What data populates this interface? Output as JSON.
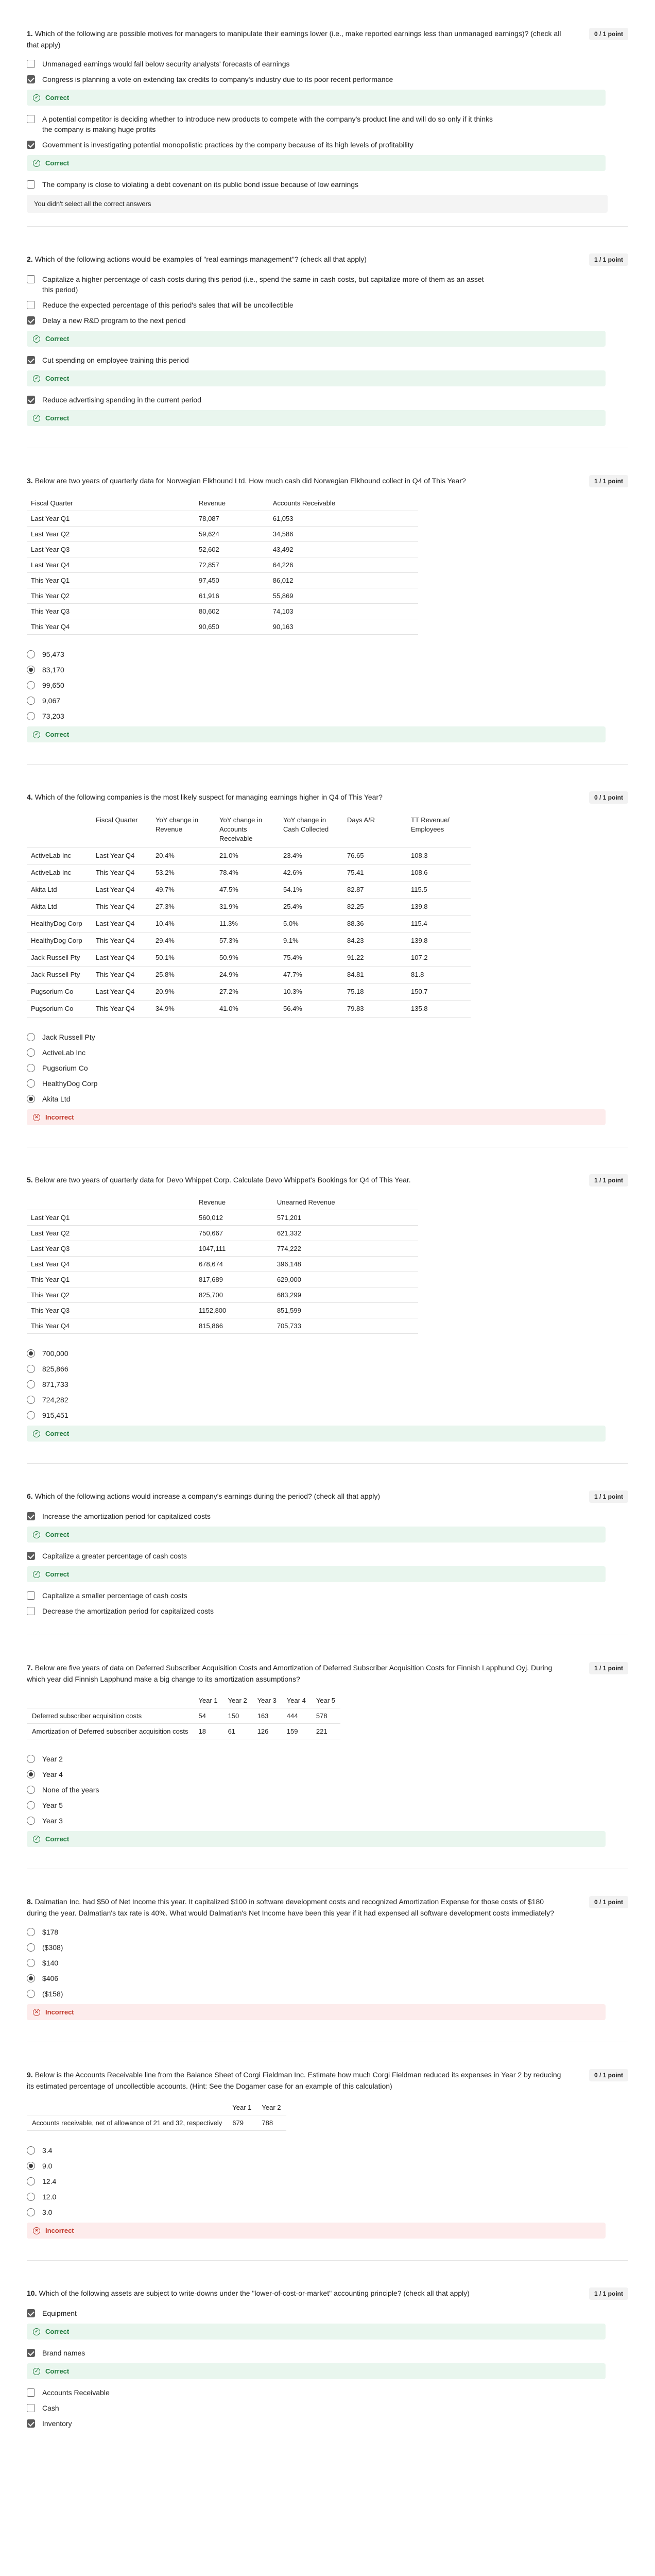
{
  "colors": {
    "correct_bg": "#e9f6ee",
    "correct_text": "#1f7a3d",
    "incorrect_bg": "#fdecec",
    "incorrect_text": "#c0392b",
    "check": "#5a5a5a"
  },
  "icons": {
    "correct": "check-circle-icon",
    "incorrect": "x-circle-icon"
  },
  "q1": {
    "num": "1.",
    "text": "Which of the following are possible motives for managers to manipulate their earnings lower (i.e., make reported earnings less than unmanaged earnings)? (check all that apply)",
    "points": "0 / 1 point",
    "options": [
      {
        "label": "Unmanaged earnings would fall below security analysts' forecasts of earnings",
        "checked": false
      },
      {
        "label": "Congress is planning a vote on extending tax credits to company's industry due to its poor recent performance",
        "checked": true,
        "feedback": "Correct"
      },
      {
        "label": "A potential competitor is deciding whether to introduce new products to compete with the company's product line and will do so only if it thinks the company is making huge profits",
        "checked": false
      },
      {
        "label": "Government is investigating potential monopolistic practices by the company because of its high levels of profitability",
        "checked": true,
        "feedback": "Correct"
      },
      {
        "label": "The company is close to violating a debt covenant on its public bond issue because of low earnings",
        "checked": false
      }
    ],
    "note": "You didn't select all the correct answers"
  },
  "q2": {
    "num": "2.",
    "text": "Which of the following actions would be examples of \"real earnings management\"? (check all that apply)",
    "points": "1 / 1 point",
    "options": [
      {
        "label": "Capitalize a higher percentage of cash costs during this period (i.e., spend the same in cash costs, but capitalize more of them as an asset this period)",
        "checked": false
      },
      {
        "label": "Reduce the expected percentage of this period's sales that will be uncollectible",
        "checked": false
      },
      {
        "label": "Delay a new R&D program to the next period",
        "checked": true,
        "feedback": "Correct"
      },
      {
        "label": "Cut spending on employee training this period",
        "checked": true,
        "feedback": "Correct"
      },
      {
        "label": "Reduce advertising spending in the current period",
        "checked": true,
        "feedback": "Correct"
      }
    ]
  },
  "q3": {
    "num": "3.",
    "text": "Below are two years of quarterly data for Norwegian Elkhound Ltd. How much cash did Norwegian Elkhound collect in Q4 of This Year?",
    "points": "1 / 1 point",
    "headers": [
      "Fiscal Quarter",
      "Revenue",
      "Accounts Receivable"
    ],
    "rows": [
      [
        "Last Year Q1",
        "78,087",
        "61,053"
      ],
      [
        "Last Year Q2",
        "59,624",
        "34,586"
      ],
      [
        "Last Year Q3",
        "52,602",
        "43,492"
      ],
      [
        "Last Year Q4",
        "72,857",
        "64,226"
      ],
      [
        "This Year Q1",
        "97,450",
        "86,012"
      ],
      [
        "This Year Q2",
        "61,916",
        "55,869"
      ],
      [
        "This Year Q3",
        "80,602",
        "74,103"
      ],
      [
        "This Year Q4",
        "90,650",
        "90,163"
      ]
    ],
    "options": [
      {
        "label": "95,473",
        "checked": false
      },
      {
        "label": "83,170",
        "checked": true
      },
      {
        "label": "99,650",
        "checked": false
      },
      {
        "label": "9,067",
        "checked": false
      },
      {
        "label": "73,203",
        "checked": false
      }
    ],
    "feedback": "Correct"
  },
  "q4": {
    "num": "4.",
    "text": "Which of the following companies is the most likely suspect for managing earnings higher in Q4 of This Year?",
    "points": "0 / 1 point",
    "headers": [
      "",
      "Fiscal Quarter",
      "YoY change in Revenue",
      "YoY change in Accounts Receivable",
      "YoY change in Cash Collected",
      "Days A/R",
      "TT Revenue/ Employees"
    ],
    "rows": [
      [
        "ActiveLab Inc",
        "Last Year Q4",
        "20.4%",
        "21.0%",
        "23.4%",
        "76.65",
        "108.3"
      ],
      [
        "ActiveLab Inc",
        "This Year Q4",
        "53.2%",
        "78.4%",
        "42.6%",
        "75.41",
        "108.6"
      ],
      [
        "Akita Ltd",
        "Last Year Q4",
        "49.7%",
        "47.5%",
        "54.1%",
        "82.87",
        "115.5"
      ],
      [
        "Akita Ltd",
        "This Year Q4",
        "27.3%",
        "31.9%",
        "25.4%",
        "82.25",
        "139.8"
      ],
      [
        "HealthyDog Corp",
        "Last Year Q4",
        "10.4%",
        "11.3%",
        "5.0%",
        "88.36",
        "115.4"
      ],
      [
        "HealthyDog Corp",
        "This Year Q4",
        "29.4%",
        "57.3%",
        "9.1%",
        "84.23",
        "139.8"
      ],
      [
        "Jack Russell Pty",
        "Last Year Q4",
        "50.1%",
        "50.9%",
        "75.4%",
        "91.22",
        "107.2"
      ],
      [
        "Jack Russell Pty",
        "This Year Q4",
        "25.8%",
        "24.9%",
        "47.7%",
        "84.81",
        "81.8"
      ],
      [
        "Pugsorium Co",
        "Last Year Q4",
        "20.9%",
        "27.2%",
        "10.3%",
        "75.18",
        "150.7"
      ],
      [
        "Pugsorium Co",
        "This Year Q4",
        "34.9%",
        "41.0%",
        "56.4%",
        "79.83",
        "135.8"
      ]
    ],
    "options": [
      {
        "label": "Jack Russell Pty",
        "checked": false
      },
      {
        "label": "ActiveLab Inc",
        "checked": false
      },
      {
        "label": "Pugsorium Co",
        "checked": false
      },
      {
        "label": "HealthyDog Corp",
        "checked": false
      },
      {
        "label": "Akita Ltd",
        "checked": true
      }
    ],
    "feedback": "Incorrect"
  },
  "q5": {
    "num": "5.",
    "text": "Below are two years of quarterly data for Devo Whippet Corp. Calculate Devo Whippet's Bookings for Q4 of This Year.",
    "points": "1 / 1 point",
    "headers": [
      "",
      "Revenue",
      "Unearned Revenue"
    ],
    "rows": [
      [
        "Last Year Q1",
        "560,012",
        "571,201"
      ],
      [
        "Last Year Q2",
        "750,667",
        "621,332"
      ],
      [
        "Last Year Q3",
        "1047,111",
        "774,222"
      ],
      [
        "Last Year Q4",
        "678,674",
        "396,148"
      ],
      [
        "This Year Q1",
        "817,689",
        "629,000"
      ],
      [
        "This Year Q2",
        "825,700",
        "683,299"
      ],
      [
        "This Year Q3",
        "1152,800",
        "851,599"
      ],
      [
        "This Year Q4",
        "815,866",
        "705,733"
      ]
    ],
    "options": [
      {
        "label": "700,000",
        "checked": true
      },
      {
        "label": "825,866",
        "checked": false
      },
      {
        "label": "871,733",
        "checked": false
      },
      {
        "label": "724,282",
        "checked": false
      },
      {
        "label": "915,451",
        "checked": false
      }
    ],
    "feedback": "Correct"
  },
  "q6": {
    "num": "6.",
    "text": "Which of the following actions would increase a company's earnings during the period? (check all that apply)",
    "points": "1 / 1 point",
    "options": [
      {
        "label": "Increase the amortization period for capitalized costs",
        "checked": true,
        "feedback": "Correct"
      },
      {
        "label": "Capitalize a greater percentage of cash costs",
        "checked": true,
        "feedback": "Correct"
      },
      {
        "label": "Capitalize a smaller percentage of cash costs",
        "checked": false
      },
      {
        "label": "Decrease the amortization period for capitalized costs",
        "checked": false
      }
    ]
  },
  "q7": {
    "num": "7.",
    "text": "Below are five years of data on Deferred Subscriber Acquisition Costs and Amortization of Deferred Subscriber Acquisition Costs for Finnish Lapphund Oyj. During which year did Finnish Lapphund make a big change to its amortization assumptions?",
    "points": "1 / 1 point",
    "headers": [
      "",
      "Year 1",
      "Year 2",
      "Year 3",
      "Year 4",
      "Year 5"
    ],
    "rows": [
      [
        "Deferred subscriber acquisition costs",
        "54",
        "150",
        "163",
        "444",
        "578"
      ],
      [
        "Amortization of Deferred subscriber acquisition costs",
        "18",
        "61",
        "126",
        "159",
        "221"
      ]
    ],
    "options": [
      {
        "label": "Year 2",
        "checked": false
      },
      {
        "label": "Year 4",
        "checked": true
      },
      {
        "label": "None of the years",
        "checked": false
      },
      {
        "label": "Year 5",
        "checked": false
      },
      {
        "label": "Year 3",
        "checked": false
      }
    ],
    "feedback": "Correct"
  },
  "q8": {
    "num": "8.",
    "text": "Dalmatian Inc. had $50 of Net Income this year. It capitalized $100 in software development costs and recognized Amortization Expense for those costs of $180 during the year. Dalmatian's tax rate is 40%. What would Dalmatian's Net Income have been this year if it had expensed all software development costs immediately?",
    "points": "0 / 1 point",
    "options": [
      {
        "label": "$178",
        "checked": false
      },
      {
        "label": "($308)",
        "checked": false
      },
      {
        "label": "$140",
        "checked": false
      },
      {
        "label": "$406",
        "checked": true
      },
      {
        "label": "($158)",
        "checked": false
      }
    ],
    "feedback": "Incorrect"
  },
  "q9": {
    "num": "9.",
    "text": "Below is the Accounts Receivable line from the Balance Sheet of Corgi Fieldman Inc. Estimate how much Corgi Fieldman reduced its expenses in Year 2 by reducing its estimated percentage of uncollectible accounts. (Hint: See the Dogamer case for an example of this calculation)",
    "points": "0 / 1 point",
    "headers": [
      "",
      "Year 1",
      "Year 2"
    ],
    "rows": [
      [
        "Accounts receivable, net of allowance of 21 and 32, respectively",
        "679",
        "788"
      ]
    ],
    "options": [
      {
        "label": "3.4",
        "checked": false
      },
      {
        "label": "9.0",
        "checked": true
      },
      {
        "label": "12.4",
        "checked": false
      },
      {
        "label": "12.0",
        "checked": false
      },
      {
        "label": "3.0",
        "checked": false
      }
    ],
    "feedback": "Incorrect"
  },
  "q10": {
    "num": "10.",
    "text": "Which of the following assets are subject to write-downs under the \"lower-of-cost-or-market\" accounting principle? (check all that apply)",
    "points": "1 / 1 point",
    "options": [
      {
        "label": "Equipment",
        "checked": true,
        "feedback": "Correct"
      },
      {
        "label": "Brand names",
        "checked": true,
        "feedback": "Correct"
      },
      {
        "label": "Accounts Receivable",
        "checked": false
      },
      {
        "label": "Cash",
        "checked": false
      },
      {
        "label": "Inventory",
        "checked": true
      }
    ]
  }
}
